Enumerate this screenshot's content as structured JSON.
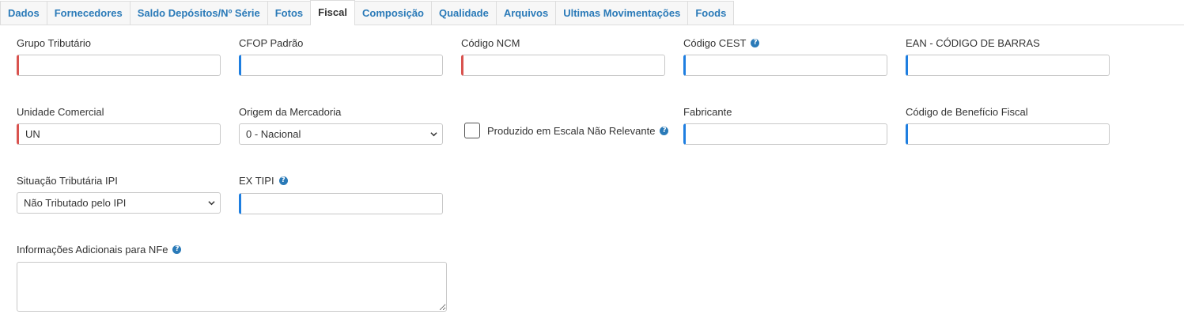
{
  "tabs": [
    {
      "label": "Dados"
    },
    {
      "label": "Fornecedores"
    },
    {
      "label": "Saldo Depósitos/Nº Série"
    },
    {
      "label": "Fotos"
    },
    {
      "label": "Fiscal"
    },
    {
      "label": "Composição"
    },
    {
      "label": "Qualidade"
    },
    {
      "label": "Arquivos"
    },
    {
      "label": "Ultimas Movimentações"
    },
    {
      "label": "Foods"
    }
  ],
  "active_tab": "Fiscal",
  "colors": {
    "required": "#d9534f",
    "optional": "#1e7ee0",
    "link": "#2a7ab8"
  },
  "fields": {
    "grupo_tributario": {
      "label": "Grupo Tributário",
      "value": "",
      "required": true
    },
    "cfop_padrao": {
      "label": "CFOP Padrão",
      "value": "",
      "required": false
    },
    "codigo_ncm": {
      "label": "Código NCM",
      "value": "",
      "required": true
    },
    "codigo_cest": {
      "label": "Código CEST",
      "value": "",
      "required": false,
      "help": "?"
    },
    "ean": {
      "label": "EAN - CÓDIGO DE BARRAS",
      "value": "",
      "required": false
    },
    "unidade_comercial": {
      "label": "Unidade Comercial",
      "value": "UN",
      "required": true
    },
    "origem_mercadoria": {
      "label": "Origem da Mercadoria",
      "selected": "0 - Nacional",
      "required": true
    },
    "escala_nao_relevante": {
      "label": "Produzido em Escala Não Relevante",
      "checked": false,
      "help": "?"
    },
    "fabricante": {
      "label": "Fabricante",
      "value": "",
      "required": false
    },
    "codigo_beneficio_fiscal": {
      "label": "Código de Benefício Fiscal",
      "value": "",
      "required": false
    },
    "situacao_tributaria_ipi": {
      "label": "Situação Tributária IPI",
      "selected": "Não Tributado pelo IPI",
      "required": false
    },
    "ex_tipi": {
      "label": "EX TIPI",
      "value": "",
      "required": false,
      "help": "?"
    },
    "info_adicionais_nfe": {
      "label": "Informações Adicionais para NFe",
      "value": "",
      "help": "?"
    }
  }
}
